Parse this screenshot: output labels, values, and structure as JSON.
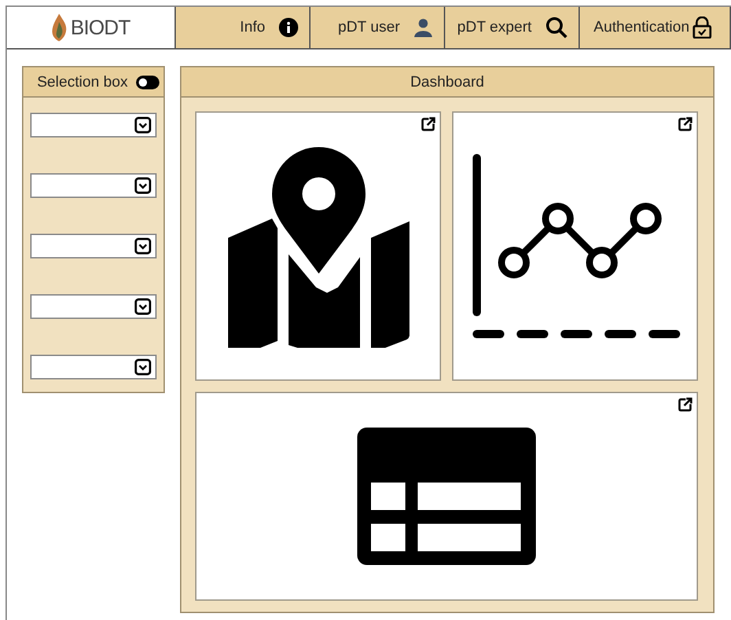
{
  "header": {
    "logo": "BIODT",
    "tabs": [
      {
        "label": "Info",
        "kind": "info"
      },
      {
        "label": "pDT user",
        "kind": "user"
      },
      {
        "label": "pDT expert",
        "kind": "search"
      },
      {
        "label": "Authentication",
        "kind": "lock"
      }
    ]
  },
  "selection_box": {
    "title": "Selection box",
    "toggle_on": false,
    "dropdowns": [
      {
        "kind": "dropdown"
      },
      {
        "kind": "dropdown"
      },
      {
        "kind": "dropdown"
      },
      {
        "kind": "dropdown"
      },
      {
        "kind": "dropdown"
      }
    ]
  },
  "dashboard": {
    "title": "Dashboard",
    "cards": [
      {
        "kind": "map"
      },
      {
        "kind": "line_chart"
      },
      {
        "kind": "table"
      }
    ]
  }
}
